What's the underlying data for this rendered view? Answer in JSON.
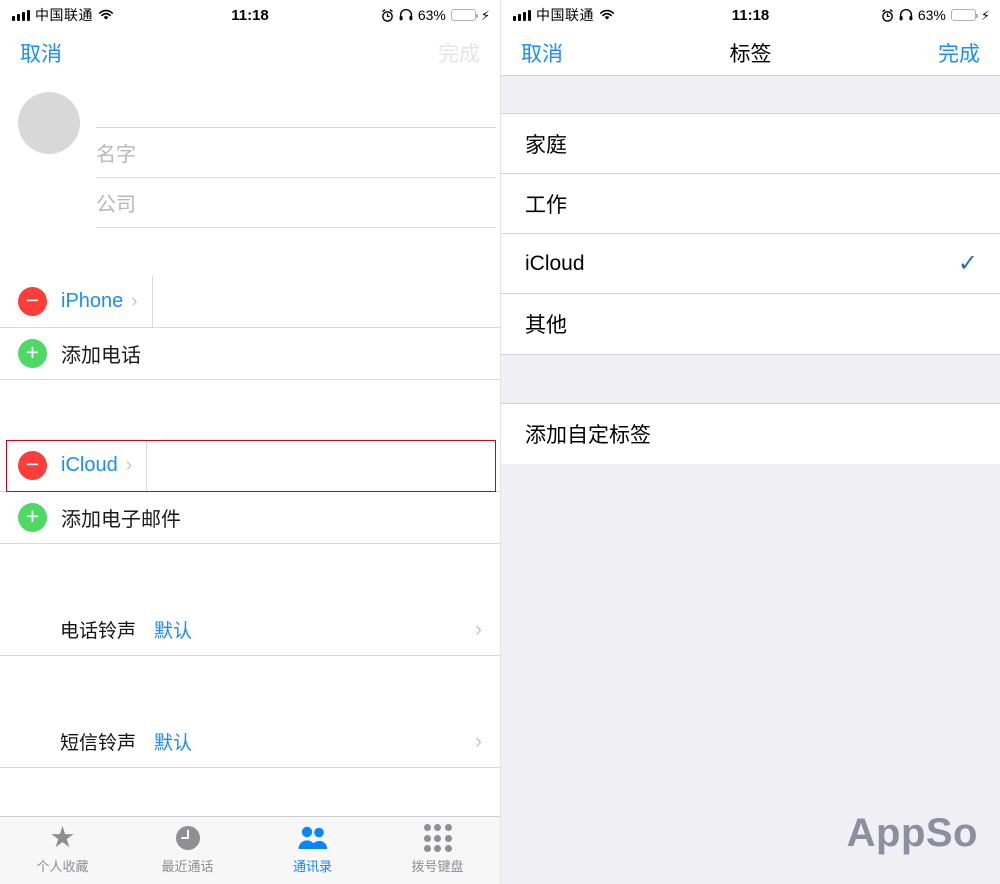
{
  "status_bar": {
    "carrier": "中国联通",
    "time": "11:18",
    "battery_percent": "63%",
    "signal_icon": "signal-bars-icon",
    "wifi_icon": "wifi-icon",
    "alarm_icon": "alarm-clock-icon",
    "headphones_icon": "headphones-icon",
    "battery_icon": "battery-icon",
    "charging_icon": "lightning-bolt-icon",
    "battery_color": "#ffcc00"
  },
  "left_panel": {
    "nav": {
      "cancel": "取消",
      "done": "完成",
      "done_enabled": false
    },
    "avatar_icon": "contact-avatar-placeholder",
    "fields": [
      {
        "placeholder": "",
        "value": ""
      },
      {
        "placeholder": "名字",
        "value": ""
      },
      {
        "placeholder": "公司",
        "value": ""
      }
    ],
    "phone_section": {
      "entry": {
        "label": "iPhone",
        "value": "",
        "remove_icon": "minus-circle-icon",
        "chevron": "›"
      },
      "add": {
        "label": "添加电话",
        "add_icon": "plus-circle-icon"
      }
    },
    "email_section": {
      "entry": {
        "label": "iCloud",
        "value": "",
        "remove_icon": "minus-circle-icon",
        "chevron": "›",
        "highlighted": true
      },
      "add": {
        "label": "添加电子邮件",
        "add_icon": "plus-circle-icon"
      }
    },
    "ringtones": [
      {
        "label": "电话铃声",
        "value": "默认",
        "chevron": "›"
      },
      {
        "label": "短信铃声",
        "value": "默认",
        "chevron": "›"
      }
    ],
    "tabs": [
      {
        "label": "个人收藏",
        "icon": "star-icon",
        "active": false
      },
      {
        "label": "最近通话",
        "icon": "clock-icon",
        "active": false
      },
      {
        "label": "通讯录",
        "icon": "contacts-people-icon",
        "active": true
      },
      {
        "label": "拨号键盘",
        "icon": "keypad-icon",
        "active": false
      }
    ],
    "accent_blue": "#1a8cff",
    "remove_red": "#fc3d39",
    "add_green": "#4cd964",
    "annotation_color": "#d0021b"
  },
  "right_panel": {
    "nav": {
      "cancel": "取消",
      "title": "标签",
      "done": "完成",
      "done_enabled": true
    },
    "labels": [
      {
        "name": "家庭",
        "selected": false
      },
      {
        "name": "工作",
        "selected": false
      },
      {
        "name": "iCloud",
        "selected": true
      },
      {
        "name": "其他",
        "selected": false
      }
    ],
    "custom": {
      "label": "添加自定标签"
    },
    "check_icon": "checkmark-icon",
    "check_color": "#1d72c4",
    "watermark": "AppSo"
  }
}
